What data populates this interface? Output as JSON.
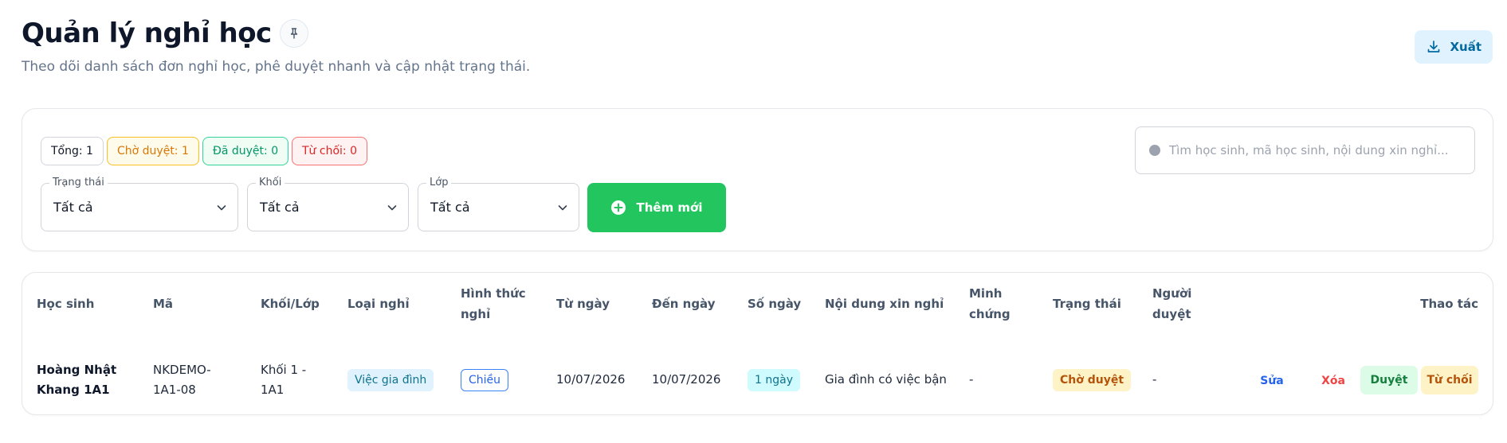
{
  "header": {
    "title": "Quản lý nghỉ học",
    "subtitle": "Theo dõi danh sách đơn nghỉ học, phê duyệt nhanh và cập nhật trạng thái.",
    "export_label": "Xuất"
  },
  "summary": {
    "total": "Tổng: 1",
    "pending": "Chờ duyệt: 1",
    "approved": "Đã duyệt: 0",
    "rejected": "Từ chối: 0"
  },
  "search": {
    "placeholder": "Tìm học sinh, mã học sinh, nội dung xin nghỉ..."
  },
  "filters": {
    "status": {
      "label": "Trạng thái",
      "value": "Tất cả"
    },
    "grade": {
      "label": "Khối",
      "value": "Tất cả"
    },
    "class": {
      "label": "Lớp",
      "value": "Tất cả"
    }
  },
  "add_button_label": "Thêm mới",
  "table": {
    "headers": {
      "student": "Học sinh",
      "code": "Mã",
      "grade_class": "Khối/Lớp",
      "leave_type": "Loại nghỉ",
      "form_1": "Hình thức",
      "form_2": "nghỉ",
      "from_date": "Từ ngày",
      "to_date": "Đến ngày",
      "days": "Số ngày",
      "content": "Nội dung xin nghỉ",
      "evidence_1": "Minh",
      "evidence_2": "chứng",
      "status": "Trạng thái",
      "approver_1": "Người",
      "approver_2": "duyệt",
      "actions": "Thao tác"
    },
    "rows": [
      {
        "student_1": "Hoàng Nhật",
        "student_2": "Khang 1A1",
        "code_1": "NKDEMO-",
        "code_2": "1A1-08",
        "grade_class_1": "Khối 1 -",
        "grade_class_2": "1A1",
        "leave_type": "Việc gia đình",
        "form": "Chiều",
        "from_date": "10/07/2026",
        "to_date": "10/07/2026",
        "days": "1 ngày",
        "content": "Gia đình có việc bận",
        "evidence": "-",
        "status": "Chờ duyệt",
        "approver": "-",
        "actions": {
          "edit": "Sửa",
          "delete": "Xóa",
          "approve": "Duyệt",
          "reject": "Từ chối"
        }
      }
    ]
  },
  "colors": {
    "primary_green": "#22c55e",
    "export_bg": "#e0f2fe",
    "pending": "#d97706",
    "approved": "#059669",
    "rejected": "#dc2626",
    "edit_link": "#2563eb",
    "delete_link": "#ef4444"
  }
}
